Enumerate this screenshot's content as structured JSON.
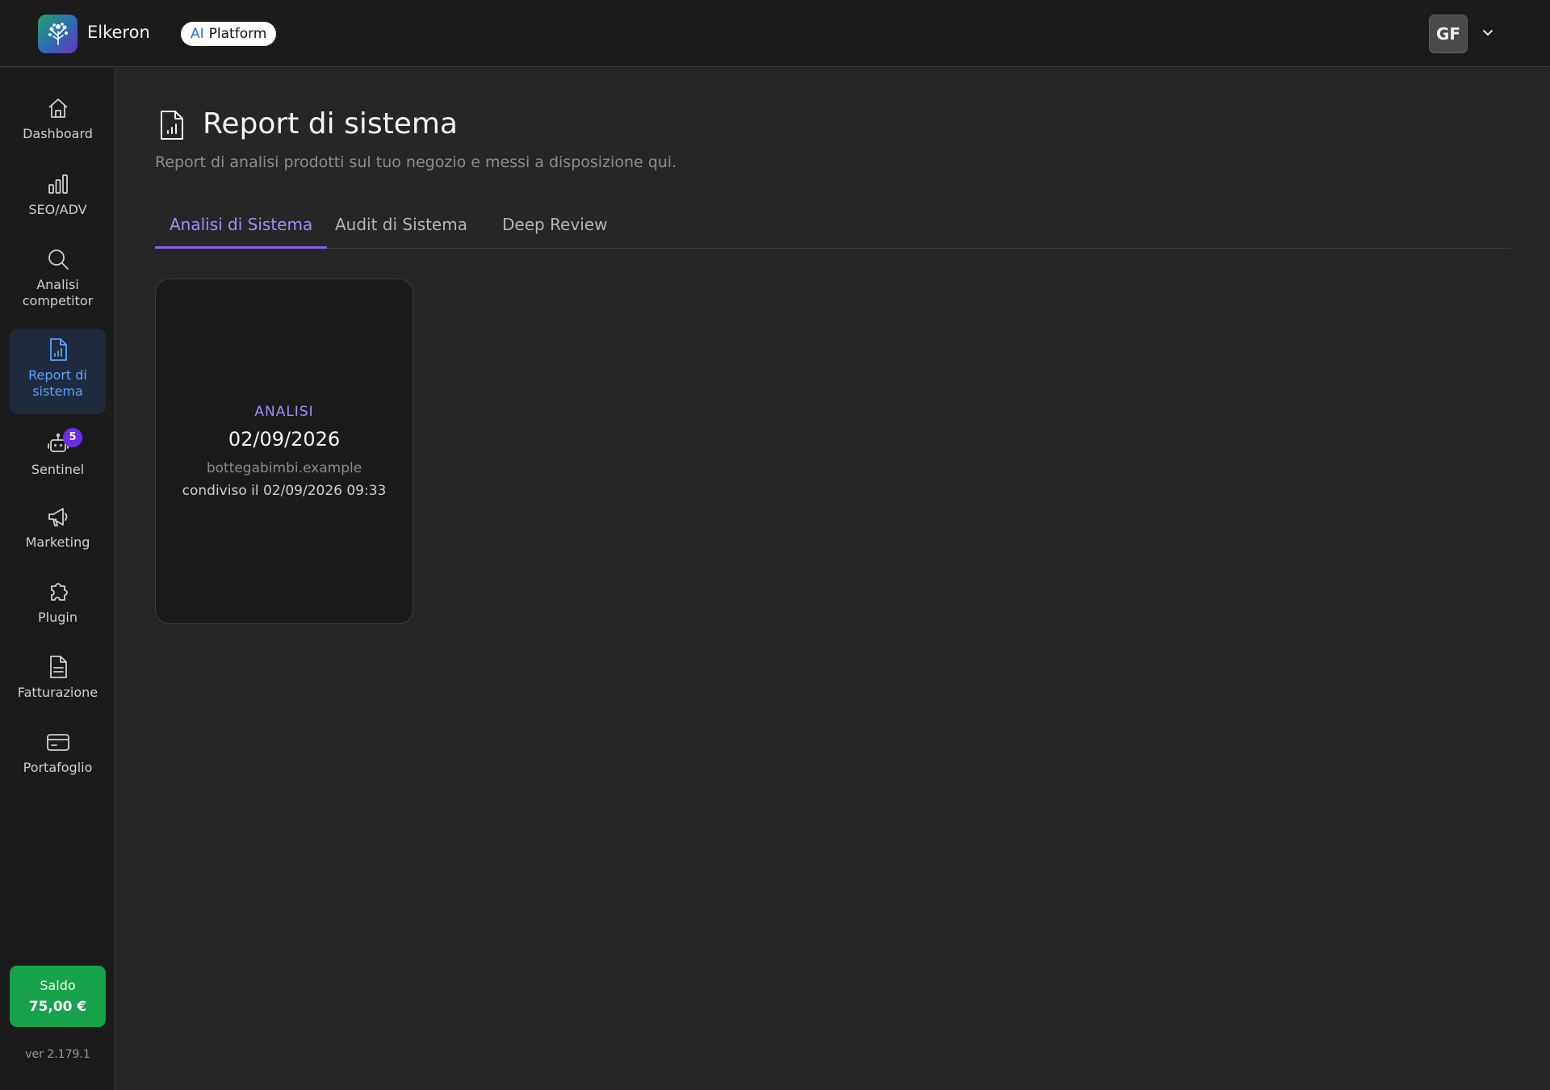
{
  "header": {
    "brand": "Elkeron",
    "pill_ai": "AI",
    "pill_label": "Platform",
    "avatar_initials": "GF"
  },
  "sidebar": {
    "items": [
      {
        "label": "Dashboard",
        "icon": "home-icon"
      },
      {
        "label": "SEO/ADV",
        "icon": "bar-chart-icon"
      },
      {
        "label": "Analisi competitor",
        "icon": "search-icon"
      },
      {
        "label": "Report di sistema",
        "icon": "report-icon",
        "active": true
      },
      {
        "label": "Sentinel",
        "icon": "robot-icon",
        "badge": "5"
      },
      {
        "label": "Marketing",
        "icon": "megaphone-icon"
      },
      {
        "label": "Plugin",
        "icon": "puzzle-icon"
      },
      {
        "label": "Fatturazione",
        "icon": "invoice-icon"
      },
      {
        "label": "Portafoglio",
        "icon": "wallet-card-icon"
      }
    ],
    "saldo_label": "Saldo",
    "saldo_amount": "75,00 €",
    "version": "ver 2.179.1"
  },
  "main": {
    "title": "Report di sistema",
    "subtitle": "Report di analisi prodotti sul tuo negozio e messi a disposizione qui.",
    "tabs": [
      {
        "label": "Analisi di Sistema",
        "active": true
      },
      {
        "label": "Audit di Sistema"
      },
      {
        "label": "Deep Review"
      }
    ],
    "cards": [
      {
        "type": "ANALISI",
        "date": "02/09/2026",
        "site": "bottegabimbi.example",
        "shared": "condiviso il 02/09/2026 09:33"
      }
    ]
  },
  "colors": {
    "accent": "#8b5cf6",
    "active_nav": "#5aa2ff",
    "saldo_bg": "#16a34a",
    "badge": "#6b2ee8"
  }
}
